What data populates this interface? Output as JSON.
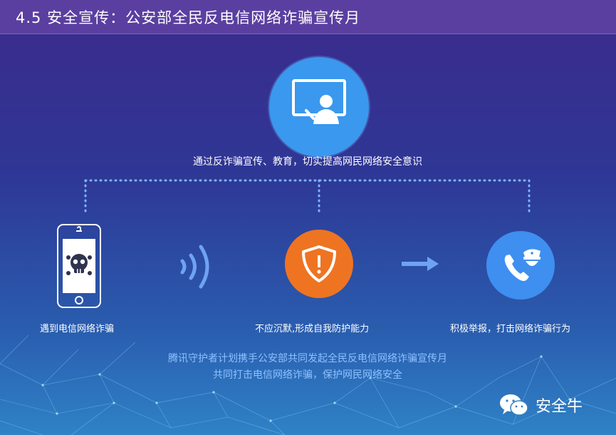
{
  "header": {
    "title": "4.5 安全宣传：公安部全民反电信网络诈骗宣传月"
  },
  "top": {
    "icon": "presentation-screen-icon",
    "caption": "通过反诈骗宣传、教育，切实提高网民网络安全意识"
  },
  "steps": [
    {
      "icon": "phone-skull-icon",
      "label": "遇到电信网络诈骗"
    },
    {
      "icon": "shield-alert-icon",
      "label": "不应沉默,形成自我防护能力"
    },
    {
      "icon": "police-phone-icon",
      "label": "积极举报，打击网络诈骗行为"
    }
  ],
  "connectors": {
    "signal": "signal-waves-icon",
    "arrow": "arrow-right-icon"
  },
  "footer": {
    "line1": "腾讯守护者计划携手公安部共同发起全民反电信网络诈骗宣传月",
    "line2": "共同打击电信网络诈骗，保护网民网络安全"
  },
  "brand": {
    "icon": "wechat-icon",
    "name": "安全牛"
  },
  "colors": {
    "header": "#5b3fa0",
    "top_circle": "#3a98ee",
    "shield_circle": "#ee7422",
    "police_circle": "#3e8ff0",
    "footer_text": "#8fc0ff"
  }
}
